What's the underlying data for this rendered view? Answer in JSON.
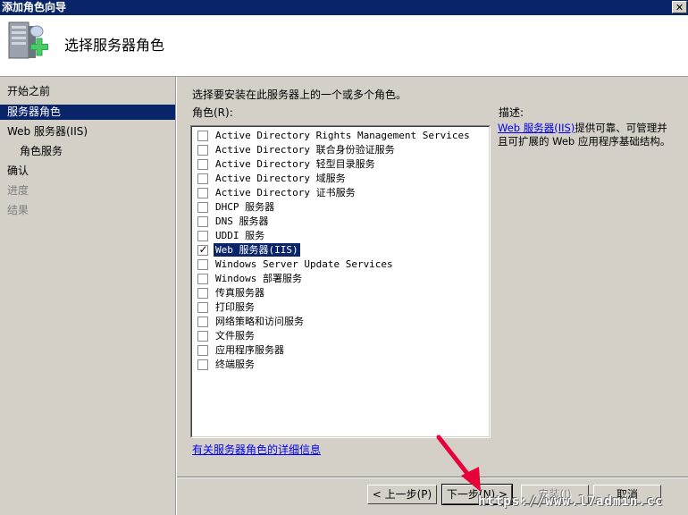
{
  "window": {
    "title": "添加角色向导",
    "close_glyph": "✕"
  },
  "header": {
    "heading": "选择服务器角色",
    "icon": "server-add-icon"
  },
  "steps": [
    {
      "label": "开始之前",
      "state": "normal"
    },
    {
      "label": "服务器角色",
      "state": "active"
    },
    {
      "label": "Web 服务器(IIS)",
      "state": "normal"
    },
    {
      "label": "角色服务",
      "state": "normal"
    },
    {
      "label": "确认",
      "state": "normal"
    },
    {
      "label": "进度",
      "state": "disabled"
    },
    {
      "label": "结果",
      "state": "disabled"
    }
  ],
  "content": {
    "instruction": "选择要安装在此服务器上的一个或多个角色。",
    "roles_label": "角色(R):",
    "description_label": "描述:",
    "roles": [
      {
        "label": "Active Directory Rights Management Services",
        "checked": false
      },
      {
        "label": "Active Directory 联合身份验证服务",
        "checked": false
      },
      {
        "label": "Active Directory 轻型目录服务",
        "checked": false
      },
      {
        "label": "Active Directory 域服务",
        "checked": false
      },
      {
        "label": "Active Directory 证书服务",
        "checked": false
      },
      {
        "label": "DHCP 服务器",
        "checked": false
      },
      {
        "label": "DNS 服务器",
        "checked": false
      },
      {
        "label": "UDDI 服务",
        "checked": false
      },
      {
        "label": "Web 服务器(IIS)",
        "checked": true,
        "selected": true
      },
      {
        "label": "Windows Server Update Services",
        "checked": false
      },
      {
        "label": "Windows 部署服务",
        "checked": false
      },
      {
        "label": "传真服务器",
        "checked": false
      },
      {
        "label": "打印服务",
        "checked": false
      },
      {
        "label": "网络策略和访问服务",
        "checked": false
      },
      {
        "label": "文件服务",
        "checked": false
      },
      {
        "label": "应用程序服务器",
        "checked": false
      },
      {
        "label": "终端服务",
        "checked": false
      }
    ],
    "check_glyph": "✓",
    "description_link": "Web 服务器(IIS)",
    "description_text": "提供可靠、可管理并且可扩展的 Web 应用程序基础结构。",
    "more_info_link": "有关服务器角色的详细信息"
  },
  "buttons": {
    "back": "< 上一步(P)",
    "next": "下一步(N) >",
    "install": "安装(I)",
    "cancel": "取消"
  },
  "watermark": "https://www.l7admin.cc",
  "colors": {
    "selection": "#0a246a",
    "face": "#d4d0c8",
    "link": "#0000ee",
    "arrow": "#e8003a"
  }
}
